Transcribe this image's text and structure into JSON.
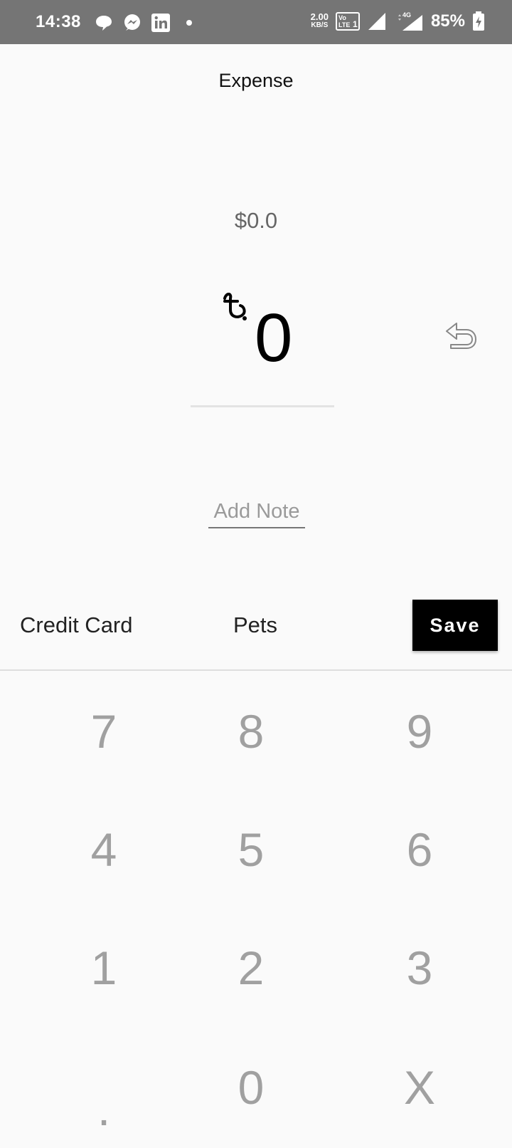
{
  "status_bar": {
    "time": "14:38",
    "net_speed_value": "2.00",
    "net_speed_unit": "KB/S",
    "network_type": "4G",
    "battery": "85%",
    "notification_icons": [
      "chat-bubble-icon",
      "messenger-icon",
      "linkedin-icon"
    ]
  },
  "header": {
    "title": "Expense"
  },
  "amount": {
    "converted": "$0.0",
    "currency_symbol": "৳",
    "value": "0"
  },
  "note": {
    "placeholder": "Add Note",
    "value": ""
  },
  "options": {
    "account": "Credit Card",
    "category": "Pets",
    "save_label": "Save"
  },
  "keypad": {
    "keys": [
      "7",
      "8",
      "9",
      "4",
      "5",
      "6",
      "1",
      "2",
      "3",
      ".",
      "0",
      "X"
    ]
  },
  "colors": {
    "status_bar_bg": "#757575",
    "background": "#fafafa",
    "save_button_bg": "#000000",
    "keypad_text": "#a0a0a0"
  }
}
